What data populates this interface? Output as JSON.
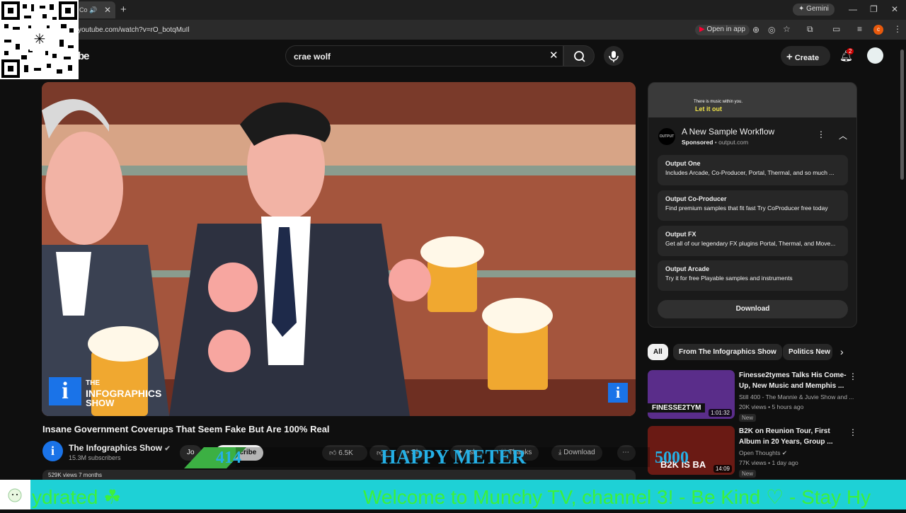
{
  "browser": {
    "tab_title": "Co",
    "url": "youtube.com/watch?v=rO_botqMuIl",
    "open_in_app": "Open in app",
    "gemini": "Gemini",
    "profile_initial": "c"
  },
  "youtube": {
    "logo_partial": "be",
    "search_value": "crae wolf",
    "create_label": "Create",
    "notification_count": "2"
  },
  "video": {
    "title": "Insane Government Coverups That Seem Fake But Are 100% Real",
    "channel": "The Infographics Show",
    "subscribers": "15.3M subscribers",
    "join_label": "Jo",
    "subscribe_label": "Subscribe",
    "likes": "6.5K",
    "share_label": "Sh",
    "ask_label": "Ask",
    "thanks_label": "Thanks",
    "download_label": "Download",
    "watermark_line1": "THE",
    "watermark_line2": "INFOGRAPHICS",
    "watermark_line3": "SHOW",
    "views_partial": "529K views  7 months"
  },
  "ad": {
    "thumb_text1": "There is music within you.",
    "thumb_text2": "Let it out",
    "brand_logo": "OUTPUT",
    "title": "A New Sample Workflow",
    "sponsored": "Sponsored",
    "domain": "output.com",
    "items": [
      {
        "title": "Output One",
        "desc": "Includes Arcade, Co-Producer, Portal, Thermal, and so much ..."
      },
      {
        "title": "Output Co-Producer",
        "desc": "Find premium samples that fit fast Try CoProducer free today"
      },
      {
        "title": "Output FX",
        "desc": "Get all of our legendary FX plugins Portal, Thermal, and Move..."
      },
      {
        "title": "Output Arcade",
        "desc": "Try it for free Playable samples and instruments"
      }
    ],
    "download_label": "Download"
  },
  "filters": [
    "All",
    "From The Infographics Show",
    "Politics New"
  ],
  "recommendations": [
    {
      "title": "Finesse2tymes Talks His Come-Up, New Music and Memphis ...",
      "channel": "Still 400 - The Mannie & Juvie Show and ...",
      "meta": "20K views • 5 hours ago",
      "badge": "New",
      "duration": "1:01:32",
      "thumb_text": "FINESSE2TYM"
    },
    {
      "title": "B2K on Reunion Tour, First Album in 20 Years, Group ...",
      "channel": "Open Thoughts",
      "meta": "77K views • 1 day ago",
      "badge": "New",
      "duration": "14:09",
      "thumb_text": "B2K IS BA"
    }
  ],
  "overlay": {
    "meter_label": "HAPPY METER",
    "meter_value": "414",
    "meter_max": "5000",
    "ticker_text": "Welcome to Munchy TV, channel 3!  - Be Kind ♡  - Stay Hy",
    "ticker_text_left": "ydrated ☘"
  },
  "colors": {
    "bg": "#0f0f0f",
    "ticker_bg": "#1ed1d6",
    "ticker_text": "#3cf03c",
    "meter_text": "#25b0e6",
    "youtube_red": "#ff0033"
  }
}
